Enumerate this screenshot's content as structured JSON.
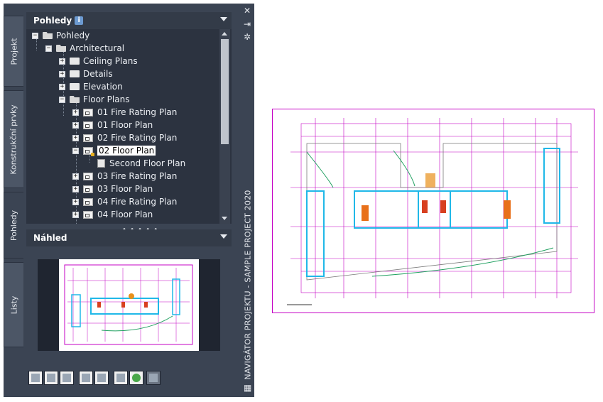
{
  "palette": {
    "rail_title": "NAVIGÁTOR PROJEKTU - SAMPLE PROJECT 2020",
    "tabs": [
      {
        "label": "Projekt"
      },
      {
        "label": "Konstrukční prvky"
      },
      {
        "label": "Pohledy"
      },
      {
        "label": "Listy"
      }
    ],
    "views_header": {
      "title": "Pohledy"
    },
    "preview_header": {
      "title": "Náhled"
    },
    "tree": [
      {
        "label": "Pohledy"
      },
      {
        "label": "Architectural"
      },
      {
        "label": "Ceiling Plans"
      },
      {
        "label": "Details"
      },
      {
        "label": "Elevation"
      },
      {
        "label": "Floor Plans"
      },
      {
        "label": "01 Fire Rating Plan"
      },
      {
        "label": "01 Floor Plan"
      },
      {
        "label": "02 Fire Rating Plan"
      },
      {
        "label": "02 Floor Plan"
      },
      {
        "label": "Second Floor Plan"
      },
      {
        "label": "03 Fire Rating Plan"
      },
      {
        "label": "03 Floor Plan"
      },
      {
        "label": "04 Fire Rating Plan"
      },
      {
        "label": "04 Floor Plan"
      }
    ],
    "colors": {
      "accent_cyan": "#20b8e8",
      "drawing_border": "#c400c4"
    }
  }
}
